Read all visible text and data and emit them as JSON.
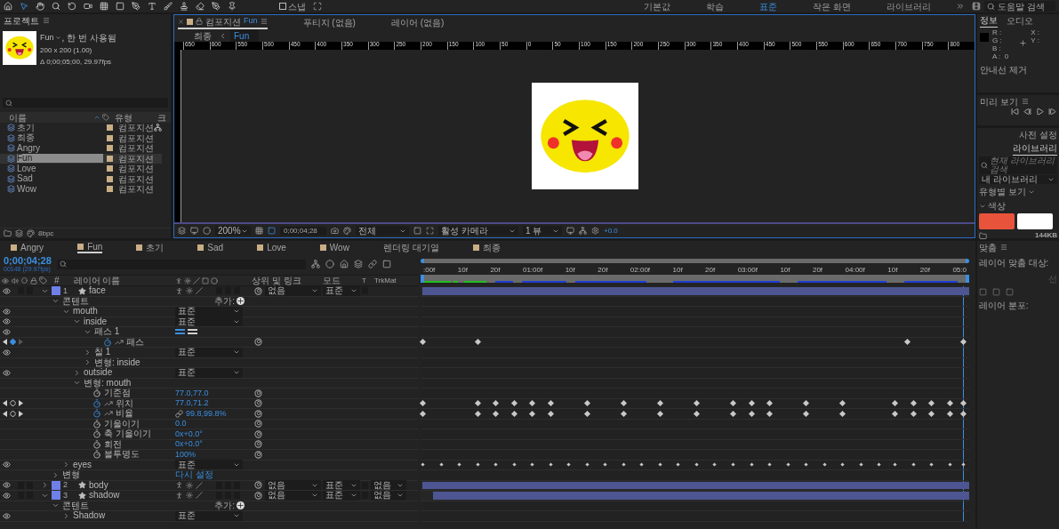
{
  "toolbar": {
    "snap": {
      "label": "스냅",
      "checked": false
    },
    "workspaces": [
      {
        "label": "기본값",
        "selected": false
      },
      {
        "label": "학습",
        "selected": false
      },
      {
        "label": "표준",
        "selected": true
      },
      {
        "label": "작은 화면",
        "selected": false
      },
      {
        "label": "라이브러리",
        "selected": false
      }
    ],
    "help_search": {
      "placeholder": "도움말 검색"
    }
  },
  "project": {
    "title": "프로젝트",
    "info": {
      "name": "Fun",
      "usage": ", 한 번 사용됨",
      "size": "200 x 200 (1.00)",
      "duration": "Δ 0;00;05;00, 29.97fps"
    },
    "columns": [
      "이름",
      "유형",
      "크"
    ],
    "items": [
      {
        "name": "초기",
        "type": "컴포지션",
        "selected": false
      },
      {
        "name": "최종",
        "type": "컴포지션",
        "selected": false
      },
      {
        "name": "Angry",
        "type": "컴포지션",
        "selected": false
      },
      {
        "name": "Fun",
        "type": "컴포지션",
        "selected": true
      },
      {
        "name": "Love",
        "type": "컴포지션",
        "selected": false
      },
      {
        "name": "Sad",
        "type": "컴포지션",
        "selected": false
      },
      {
        "name": "Wow",
        "type": "컴포지션",
        "selected": false
      }
    ],
    "bit_depth": "8bpc"
  },
  "viewer": {
    "tabs": [
      {
        "label": "컴포지션",
        "name": "Fun",
        "selected": true
      },
      {
        "label": "푸티지 (없음)",
        "selected": false
      },
      {
        "label": "레이어 (없음)",
        "selected": false
      }
    ],
    "breadcrumb": [
      {
        "label": "최종",
        "selected": false
      },
      {
        "label": "Fun",
        "selected": true
      }
    ],
    "ruler": [
      "650",
      "600",
      "550",
      "500",
      "450",
      "400",
      "350",
      "300",
      "250",
      "200",
      "150",
      "100",
      "50",
      "0",
      "50",
      "100",
      "150",
      "200",
      "250",
      "300",
      "350",
      "400",
      "450",
      "500",
      "550",
      "600",
      "650",
      "700",
      "750",
      "800"
    ],
    "zoom": "200%",
    "timecode": "0;00;04;28",
    "resolution": "전체",
    "camera": "활성 카메라",
    "views": "1 뷰",
    "exposure": "+0.0"
  },
  "info": {
    "tabs": [
      {
        "label": "정보",
        "selected": true
      },
      {
        "label": "오디오",
        "selected": false
      }
    ],
    "channels": [
      "R :",
      "G :",
      "B :",
      "A :  0"
    ],
    "coords": [
      "X :",
      "Y :"
    ],
    "guide": "안내선 제거"
  },
  "preview": {
    "title": "미리 보기"
  },
  "libraries": {
    "tabs": [
      {
        "label": "사전 설정",
        "selected": false
      },
      {
        "label": "라이브러리",
        "selected": true
      }
    ],
    "search": {
      "placeholder": "현재 라이브러리 검색"
    },
    "library": "내 라이브러리",
    "view": "유형별 보기",
    "section": "색상",
    "swatches": [
      {
        "color": "#e8533b"
      },
      {
        "color": "#ffffff"
      }
    ],
    "size": "144KB"
  },
  "align": {
    "title": "맞춤",
    "target_label": "레이어 맞춤 대상:",
    "target": "선",
    "distribute": "레이어 분포:"
  },
  "timeline": {
    "tabs": [
      {
        "label": "Angry",
        "kind": "comp",
        "selected": false
      },
      {
        "label": "Fun",
        "kind": "comp",
        "selected": true
      },
      {
        "label": "초기",
        "kind": "comp",
        "selected": false
      },
      {
        "label": "Sad",
        "kind": "comp",
        "selected": false
      },
      {
        "label": "Love",
        "kind": "comp",
        "selected": false
      },
      {
        "label": "Wow",
        "kind": "comp",
        "selected": false
      },
      {
        "label": "렌더링 대기열",
        "kind": "queue",
        "selected": false
      },
      {
        "label": "최종",
        "kind": "comp",
        "selected": false
      }
    ],
    "time": "0;00;04;28",
    "frame": "00148 (29.97fps)",
    "columns": {
      "number": "#",
      "name": "레이어 이름",
      "parent": "상위 및 링크",
      "mode": "모드",
      "t": "T",
      "trkmat": "TrkMat"
    },
    "ruler": [
      ":00f",
      "10f",
      "20f",
      "01:00f",
      "10f",
      "20f",
      "02:00f",
      "10f",
      "20f",
      "03:00f",
      "10f",
      "20f",
      "04:00f",
      "10f",
      "20f",
      "05:0"
    ],
    "layers": [
      {
        "number": "1",
        "name": "face",
        "expanded": true,
        "visible": true,
        "solo": false,
        "locked": false,
        "parent": "없음",
        "mode": "표준",
        "track": {
          "kind": "bar"
        },
        "children": [
          {
            "kind": "group",
            "name": "콘텐트",
            "expanded": true,
            "add": "추가:",
            "children": [
              {
                "kind": "group",
                "name": "mouth",
                "expanded": true,
                "visible": true,
                "mode": "표준",
                "children": [
                  {
                    "kind": "group",
                    "name": "inside",
                    "expanded": true,
                    "visible": true,
                    "mode": "표준",
                    "children": [
                      {
                        "kind": "path-group",
                        "name": "패스 1",
                        "expanded": true,
                        "visible": true,
                        "children": [
                          {
                            "kind": "property",
                            "name": "패스",
                            "animated": true,
                            "at_key": true,
                            "track": {
                              "kind": "path"
                            }
                          }
                        ]
                      },
                      {
                        "kind": "group",
                        "name": "칠 1",
                        "expanded": false,
                        "visible": true,
                        "mode": "표준"
                      },
                      {
                        "kind": "group",
                        "name": "변형: inside",
                        "expanded": false
                      }
                    ]
                  },
                  {
                    "kind": "group",
                    "name": "outside",
                    "expanded": false,
                    "visible": true,
                    "mode": "표준"
                  },
                  {
                    "kind": "group",
                    "name": "변형: mouth",
                    "expanded": true,
                    "children": [
                      {
                        "kind": "property",
                        "name": "기준점",
                        "value": "77.0,77.0",
                        "animated": false
                      },
                      {
                        "kind": "property",
                        "name": "위치",
                        "value": "77.0,71.2",
                        "animated": true,
                        "at_key": false,
                        "track": {
                          "kind": "dense"
                        }
                      },
                      {
                        "kind": "property",
                        "name": "비율",
                        "value": "99.8,99.8%",
                        "animated": true,
                        "at_key": false,
                        "linked": true,
                        "track": {
                          "kind": "dense"
                        }
                      },
                      {
                        "kind": "property",
                        "name": "기울이기",
                        "value": "0.0",
                        "animated": false
                      },
                      {
                        "kind": "property",
                        "name": "축 기울이기",
                        "value": "0x+0.0°",
                        "animated": false
                      },
                      {
                        "kind": "property",
                        "name": "회전",
                        "value": "0x+0.0°",
                        "animated": false
                      },
                      {
                        "kind": "property",
                        "name": "불투명도",
                        "value": "100%",
                        "animated": false
                      }
                    ]
                  }
                ]
              },
              {
                "kind": "group",
                "name": "eyes",
                "expanded": false,
                "visible": true,
                "mode": "표준",
                "track": {
                  "kind": "dots"
                }
              }
            ]
          },
          {
            "kind": "group",
            "name": "변형",
            "expanded": false,
            "reset": "다시 설정"
          }
        ]
      },
      {
        "number": "2",
        "name": "body",
        "expanded": false,
        "visible": true,
        "solo": false,
        "locked": false,
        "parent": "없음",
        "mode": "표준",
        "trkmat": "없음",
        "track": {
          "kind": "bar"
        }
      },
      {
        "number": "3",
        "name": "shadow",
        "expanded": true,
        "visible": true,
        "solo": false,
        "locked": false,
        "parent": "없음",
        "mode": "표준",
        "trkmat": "없음",
        "track": {
          "kind": "bar-late"
        },
        "children": [
          {
            "kind": "group",
            "name": "콘텐트",
            "expanded": true,
            "add": "추가:",
            "children": [
              {
                "kind": "group",
                "name": "Shadow",
                "expanded": false,
                "visible": true,
                "mode": "표준"
              }
            ]
          }
        ]
      }
    ]
  }
}
